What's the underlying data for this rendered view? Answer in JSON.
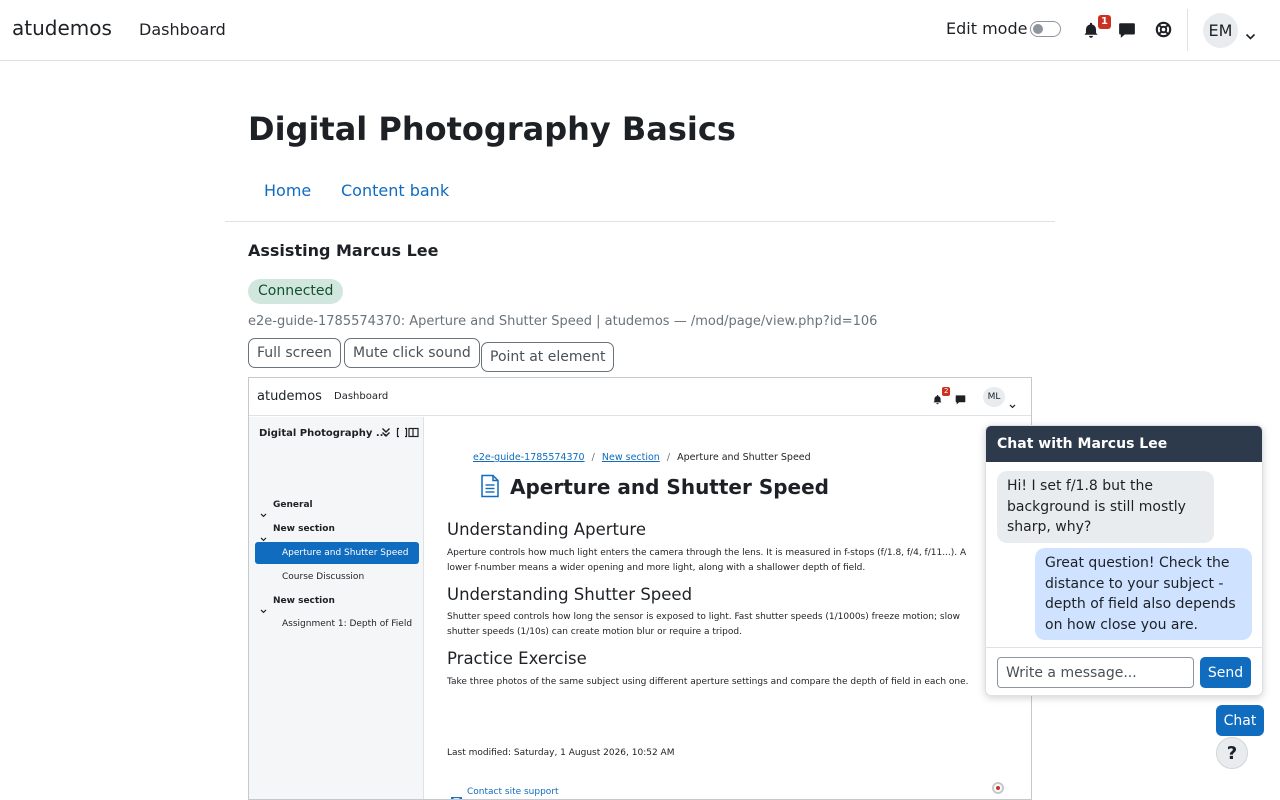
{
  "navbar": {
    "brand": "atudemos",
    "dashboard": "Dashboard",
    "edit_mode": "Edit mode",
    "notification_count": "1",
    "avatar_initials": "EM"
  },
  "page": {
    "title": "Digital Photography Basics",
    "tabs": [
      "Home",
      "Content bank"
    ],
    "assisting": "Assisting Marcus Lee",
    "status": "Connected",
    "session_line": "e2e-guide-1785574370: Aperture and Shutter Speed | atudemos — /mod/page/view.php?id=106",
    "buttons": {
      "full_screen": "Full screen",
      "mute": "Mute click sound",
      "point": "Point at element"
    }
  },
  "remote": {
    "brand": "atudemos",
    "dashboard": "Dashboard",
    "notification_count": "2",
    "avatar_initials": "ML",
    "course_title": "Digital Photography ...",
    "sidebar": {
      "general": "General",
      "section1": "New section",
      "active_item": "Aperture and Shutter Speed",
      "item2": "Course Discussion",
      "section2": "New section",
      "item3": "Assignment 1: Depth of Field"
    },
    "breadcrumb": {
      "course": "e2e-guide-1785574370",
      "section": "New section",
      "current": "Aperture and Shutter Speed",
      "separator": "/"
    },
    "title": "Aperture and Shutter Speed",
    "sections": [
      {
        "heading": "Understanding Aperture",
        "text": "Aperture controls how much light enters the camera through the lens. It is measured in f-stops (f/1.8, f/4, f/11...). A lower f-number means a wider opening and more light, along with a shallower depth of field."
      },
      {
        "heading": "Understanding Shutter Speed",
        "text": "Shutter speed controls how long the sensor is exposed to light. Fast shutter speeds (1/1000s) freeze motion; slow shutter speeds (1/10s) can create motion blur or require a tripod."
      },
      {
        "heading": "Practice Exercise",
        "text": "Take three photos of the same subject using different aperture settings and compare the depth of field in each one."
      }
    ],
    "last_modified": "Last modified: Saturday, 1 August 2026, 10:52 AM",
    "contact": "Contact site support"
  },
  "chat": {
    "title": "Chat with Marcus Lee",
    "messages": [
      {
        "from": "Marcus Lee",
        "text": "Hi! I set f/1.8 but the background is still mostly sharp, why?"
      },
      {
        "from": "me",
        "text": "Great question! Check the distance to your subject - depth of field also depends on how close you are."
      }
    ],
    "input_placeholder": "Write a message...",
    "send": "Send",
    "fab": "Chat",
    "help": "?"
  },
  "colors": {
    "brand_blue": "#0f6cbf",
    "chat_header": "#2c3a4b",
    "connected_bg": "#d1e7dd",
    "badge_red": "#ca3120"
  },
  "icons": [
    "bell-icon",
    "message-icon",
    "lifebuoy-icon",
    "chevron-down-icon",
    "page-file-icon",
    "envelope-icon",
    "collapse-icon"
  ]
}
